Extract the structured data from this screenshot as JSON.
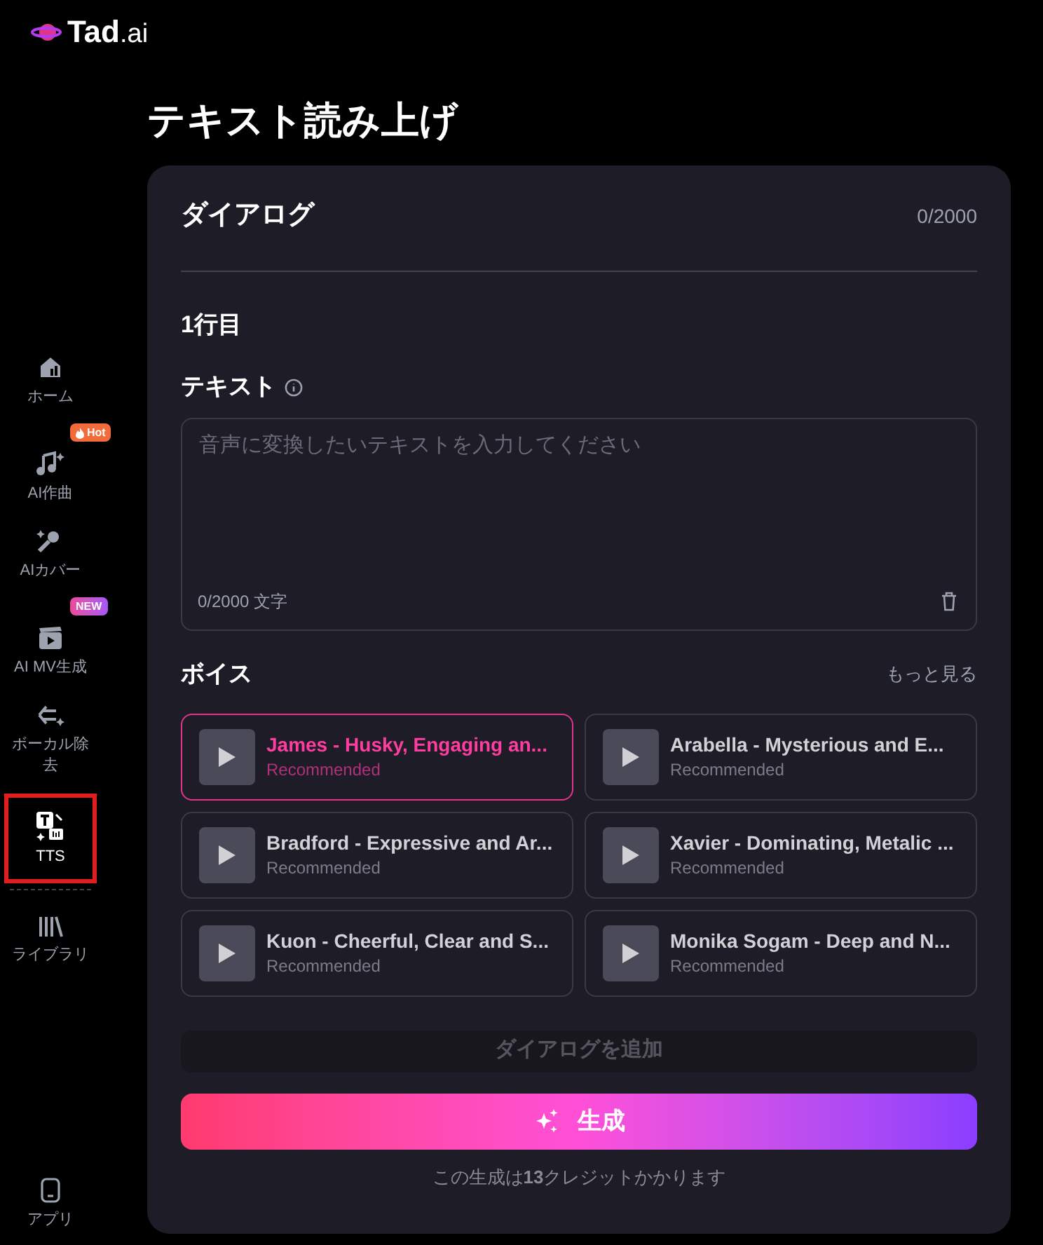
{
  "logo": {
    "text": "Tad",
    "suffix": ".ai"
  },
  "sidebar": {
    "items": [
      {
        "kind": "home",
        "label": "ホーム",
        "selected": false
      },
      {
        "kind": "music",
        "label": "AI作曲",
        "selected": false,
        "badge": "Hot"
      },
      {
        "kind": "cover",
        "label": "AIカバー",
        "selected": false
      },
      {
        "kind": "mv",
        "label": "AI MV生成",
        "selected": false,
        "badge": "NEW"
      },
      {
        "kind": "vocal",
        "label": "ボーカル除去",
        "selected": false
      },
      {
        "kind": "tts",
        "label": "TTS",
        "selected": true
      },
      {
        "kind": "library",
        "label": "ライブラリ",
        "selected": false
      }
    ],
    "bottom": {
      "label": "アプリ"
    }
  },
  "page_title": "テキスト読み上げ",
  "card": {
    "title": "ダイアログ",
    "count": "0/2000",
    "row_label": "1行目",
    "text_label": "テキスト",
    "text_field": {
      "placeholder": "音声に変換したいテキストを入力してください",
      "counter": "0/2000 文字"
    },
    "voice_label": "ボイス",
    "more_link": "もっと見る",
    "voices": [
      {
        "name": "James - Husky, Engaging an...",
        "tag": "Recommended",
        "selected": true
      },
      {
        "name": "Arabella - Mysterious and E...",
        "tag": "Recommended",
        "selected": false
      },
      {
        "name": "Bradford - Expressive and Ar...",
        "tag": "Recommended",
        "selected": false
      },
      {
        "name": "Xavier - Dominating, Metalic ...",
        "tag": "Recommended",
        "selected": false
      },
      {
        "name": "Kuon - Cheerful, Clear and S...",
        "tag": "Recommended",
        "selected": false
      },
      {
        "name": "Monika Sogam - Deep and N...",
        "tag": "Recommended",
        "selected": false
      }
    ],
    "add_button": "ダイアログを追加",
    "generate_button": "生成",
    "credits_note": "この生成は**13**クレジットかかります"
  }
}
